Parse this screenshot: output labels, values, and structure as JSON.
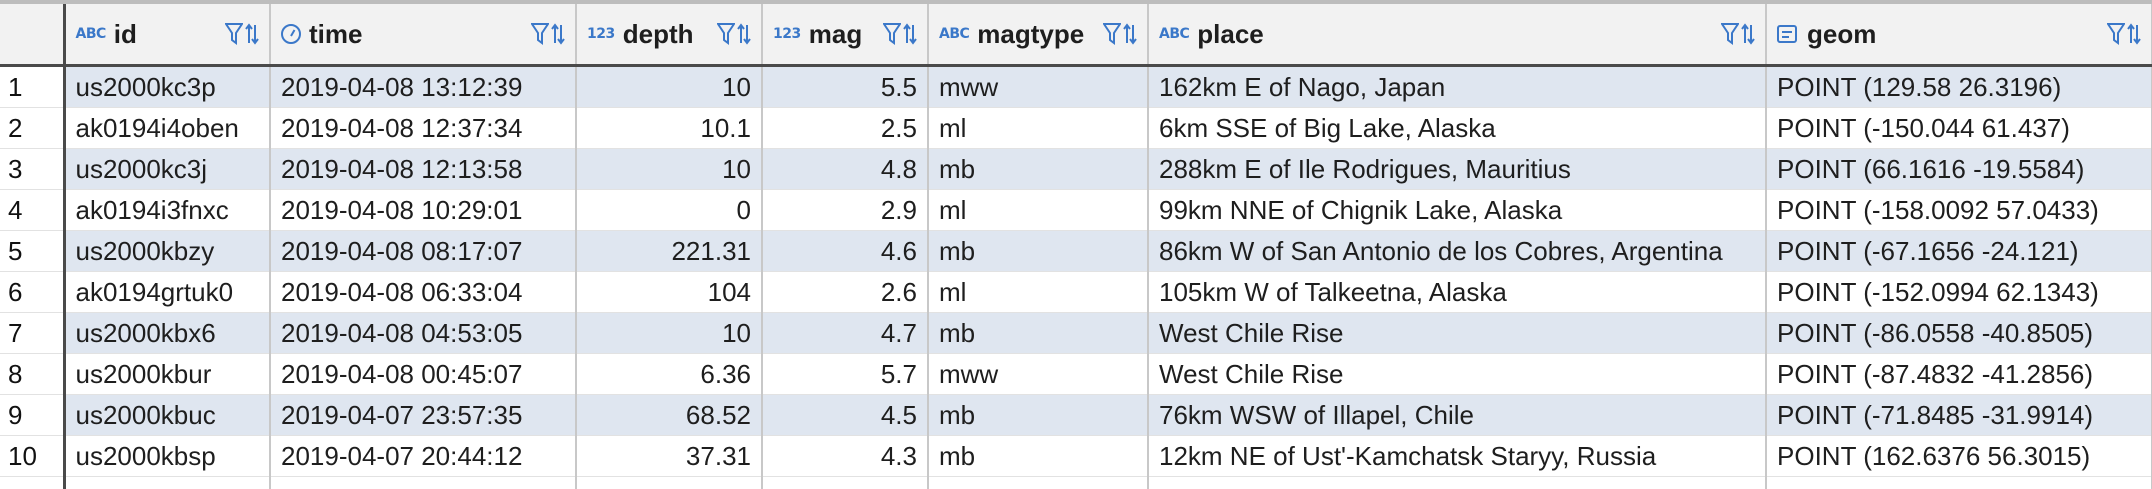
{
  "columns": [
    {
      "key": "id",
      "label": "id",
      "type_label": "ABC",
      "type_icon": "text-type-icon"
    },
    {
      "key": "time",
      "label": "time",
      "type_label": "",
      "type_icon": "clock-type-icon"
    },
    {
      "key": "depth",
      "label": "depth",
      "type_label": "123",
      "type_icon": "numeric-type-icon"
    },
    {
      "key": "mag",
      "label": "mag",
      "type_label": "123",
      "type_icon": "numeric-type-icon"
    },
    {
      "key": "magtype",
      "label": "magtype",
      "type_label": "ABC",
      "type_icon": "text-type-icon"
    },
    {
      "key": "place",
      "label": "place",
      "type_label": "ABC",
      "type_icon": "text-type-icon"
    },
    {
      "key": "geom",
      "label": "geom",
      "type_label": "",
      "type_icon": "geometry-type-icon"
    }
  ],
  "rows": [
    {
      "n": "1",
      "id": "us2000kc3p",
      "time": "2019-04-08 13:12:39",
      "depth": "10",
      "mag": "5.5",
      "magtype": "mww",
      "place": "162km E of Nago, Japan",
      "geom": "POINT (129.58 26.3196)"
    },
    {
      "n": "2",
      "id": "ak0194i4oben",
      "time": "2019-04-08 12:37:34",
      "depth": "10.1",
      "mag": "2.5",
      "magtype": "ml",
      "place": "6km SSE of Big Lake, Alaska",
      "geom": "POINT (-150.044 61.437)"
    },
    {
      "n": "3",
      "id": "us2000kc3j",
      "time": "2019-04-08 12:13:58",
      "depth": "10",
      "mag": "4.8",
      "magtype": "mb",
      "place": "288km E of Ile Rodrigues, Mauritius",
      "geom": "POINT (66.1616 -19.5584)"
    },
    {
      "n": "4",
      "id": "ak0194i3fnxc",
      "time": "2019-04-08 10:29:01",
      "depth": "0",
      "mag": "2.9",
      "magtype": "ml",
      "place": "99km NNE of Chignik Lake, Alaska",
      "geom": "POINT (-158.0092 57.0433)"
    },
    {
      "n": "5",
      "id": "us2000kbzy",
      "time": "2019-04-08 08:17:07",
      "depth": "221.31",
      "mag": "4.6",
      "magtype": "mb",
      "place": "86km W of San Antonio de los Cobres, Argentina",
      "geom": "POINT (-67.1656 -24.121)"
    },
    {
      "n": "6",
      "id": "ak0194grtuk0",
      "time": "2019-04-08 06:33:04",
      "depth": "104",
      "mag": "2.6",
      "magtype": "ml",
      "place": "105km W of Talkeetna, Alaska",
      "geom": "POINT (-152.0994 62.1343)"
    },
    {
      "n": "7",
      "id": "us2000kbx6",
      "time": "2019-04-08 04:53:05",
      "depth": "10",
      "mag": "4.7",
      "magtype": "mb",
      "place": "West Chile Rise",
      "geom": "POINT (-86.0558 -40.8505)"
    },
    {
      "n": "8",
      "id": "us2000kbur",
      "time": "2019-04-08 00:45:07",
      "depth": "6.36",
      "mag": "5.7",
      "magtype": "mww",
      "place": "West Chile Rise",
      "geom": "POINT (-87.4832 -41.2856)"
    },
    {
      "n": "9",
      "id": "us2000kbuc",
      "time": "2019-04-07 23:57:35",
      "depth": "68.52",
      "mag": "4.5",
      "magtype": "mb",
      "place": "76km WSW of Illapel, Chile",
      "geom": "POINT (-71.8485 -31.9914)"
    },
    {
      "n": "10",
      "id": "us2000kbsp",
      "time": "2019-04-07 20:44:12",
      "depth": "37.31",
      "mag": "4.3",
      "magtype": "mb",
      "place": "12km NE of Ust'-Kamchatsk Staryy, Russia",
      "geom": "POINT (162.6376 56.3015)"
    }
  ],
  "colors": {
    "header_bg": "#f2f2f2",
    "odd_row_bg": "#dfe6f0",
    "time_text": "#2e6b1e",
    "number_text": "#1a3fd4",
    "type_icon": "#3b78c9"
  }
}
